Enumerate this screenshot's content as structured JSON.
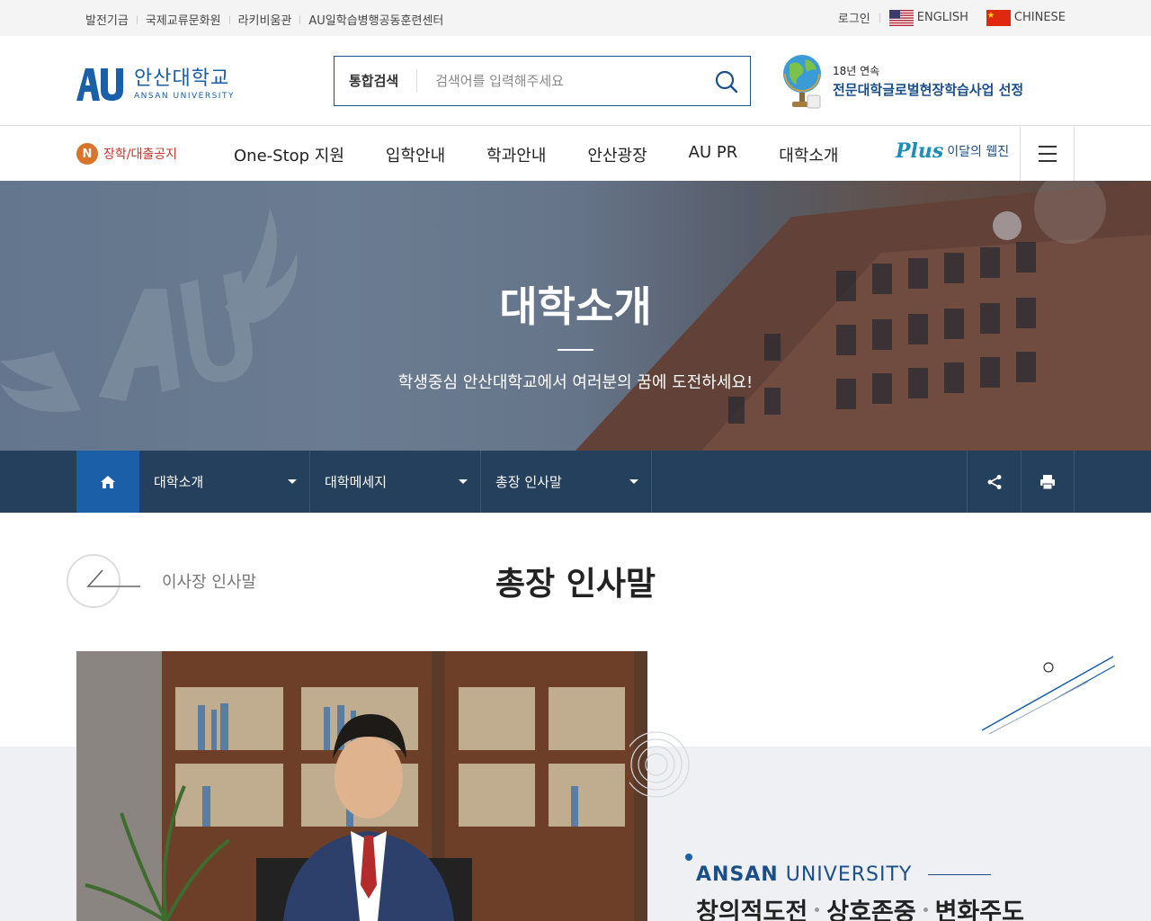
{
  "util": {
    "links": [
      "발전기금",
      "국제교류문화원",
      "라키비움관",
      "AU일학습병행공동훈련센터"
    ],
    "login": "로그인",
    "english": "ENGLISH",
    "chinese": "CHINESE"
  },
  "header": {
    "logo_kr": "안산대학교",
    "logo_en": "ANSAN UNIVERSITY",
    "search_category": "통합검색",
    "search_placeholder": "검색어를 입력해주세요",
    "award_line1": "18년 연속",
    "award_line2": "전문대학글로벌현장학습사업 선정"
  },
  "gnb": {
    "notice_badge": "N",
    "notice_text": "장학/대출공지",
    "menu": [
      "One-Stop 지원",
      "입학안내",
      "학과안내",
      "안산광장",
      "AU PR",
      "대학소개"
    ],
    "plus_logo": "Plus",
    "plus_text": "이달의 웹진"
  },
  "hero": {
    "title": "대학소개",
    "subtitle": "학생중심 안산대학교에서 여러분의 꿈에 도전하세요!"
  },
  "breadcrumb": {
    "items": [
      "대학소개",
      "대학메세지",
      "총장 인사말"
    ]
  },
  "content": {
    "prev_label": "이사장 인사말",
    "page_title": "총장 인사말",
    "motto_en_bold": "ANSAN",
    "motto_en_light": "UNIVERSITY",
    "motto_kr": [
      "창의적도전",
      "상호존중",
      "변화주도"
    ]
  },
  "colors": {
    "brand_blue": "#1a5fa8",
    "crumb_bg": "#25405c",
    "notice_orange": "#d9742c"
  }
}
